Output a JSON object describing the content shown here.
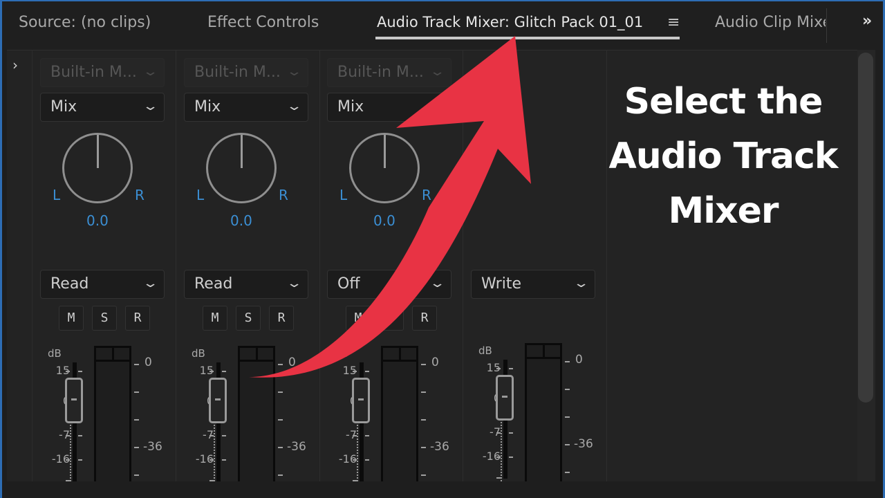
{
  "tabs": {
    "source": "Source: (no clips)",
    "effect_controls": "Effect Controls",
    "audio_track_mixer": "Audio Track Mixer: Glitch Pack 01_01",
    "menu_icon": "≡",
    "audio_clip_mixer": "Audio Clip Mixer",
    "overflow_icon": "»"
  },
  "panel": {
    "expander_icon": "›"
  },
  "tracks": [
    {
      "effect_preset": "Built-in M...",
      "send": "Mix",
      "pan_left": "L",
      "pan_right": "R",
      "pan_value": "0.0",
      "automation": "Read",
      "buttons": [
        "M",
        "S",
        "R"
      ],
      "db_label": "dB",
      "fader_scale": [
        "15",
        "0",
        "-7",
        "-16"
      ],
      "meter_scale": [
        "0",
        "-36"
      ]
    },
    {
      "effect_preset": "Built-in M...",
      "send": "Mix",
      "pan_left": "L",
      "pan_right": "R",
      "pan_value": "0.0",
      "automation": "Read",
      "buttons": [
        "M",
        "S",
        "R"
      ],
      "db_label": "dB",
      "fader_scale": [
        "15",
        "0",
        "-7",
        "-16"
      ],
      "meter_scale": [
        "0",
        "-36"
      ]
    },
    {
      "effect_preset": "Built-in M...",
      "send": "Mix",
      "pan_left": "L",
      "pan_right": "R",
      "pan_value": "0.0",
      "automation": "Off",
      "buttons": [
        "M",
        "S",
        "R"
      ],
      "db_label": "dB",
      "fader_scale": [
        "15",
        "0",
        "-7",
        "-16"
      ],
      "meter_scale": [
        "0",
        "-36"
      ]
    },
    {
      "automation": "Write",
      "db_label": "dB",
      "fader_scale": [
        "15",
        "0",
        "-7",
        "-16"
      ],
      "meter_scale": [
        "0",
        "-36"
      ]
    }
  ],
  "annotation": {
    "caption": "Select the Audio Track Mixer",
    "arrow_color": "#e83344"
  },
  "colors": {
    "accent_blue": "#3b8fd4",
    "frame_blue": "#2d6db5"
  }
}
